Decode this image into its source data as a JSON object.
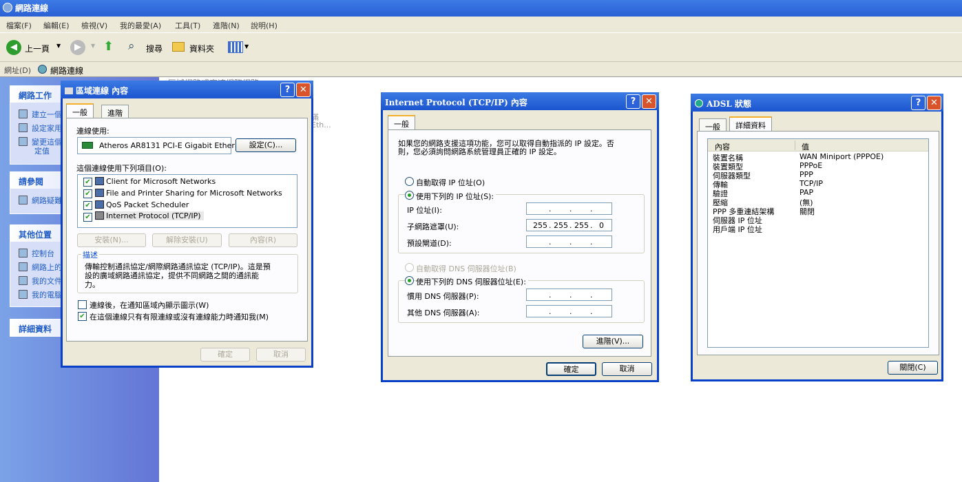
{
  "window": {
    "title": "網路連線"
  },
  "menu": [
    "檔案(F)",
    "編輯(E)",
    "檢視(V)",
    "我的最愛(A)",
    "工具(T)",
    "進階(N)",
    "說明(H)"
  ],
  "toolbar": {
    "back": "上一頁",
    "search": "搜尋",
    "folders": "資料夾"
  },
  "address": {
    "label": "網址(D)",
    "value": "網路連線"
  },
  "taskpane": {
    "network_tasks": {
      "title": "網路工作",
      "items": [
        "建立一個",
        "設定家用",
        "變更這個",
        "定值"
      ]
    },
    "see_also": {
      "title": "請參閱",
      "items": [
        "網路疑難"
      ]
    },
    "other_places": {
      "title": "其他位置",
      "items": [
        "控制台",
        "網路上的",
        "我的文件",
        "我的電腦"
      ]
    },
    "details": {
      "title": "詳細資料"
    }
  },
  "bg_fragments": [
    "區域網路或高速網際網路",
    "滿",
    "Eth..."
  ],
  "lan": {
    "title": "區域連線 內容",
    "tabs": [
      "一般",
      "進階"
    ],
    "connect_using_label": "連線使用:",
    "adapter": "Atheros AR8131 PCI-E Gigabit Ether",
    "configure": "設定(C)...",
    "items_label": "這個連線使用下列項目(O):",
    "items": [
      "Client for Microsoft Networks",
      "File and Printer Sharing for Microsoft Networks",
      "QoS Packet Scheduler",
      "Internet Protocol (TCP/IP)"
    ],
    "install": "安裝(N)...",
    "uninstall": "解除安裝(U)",
    "properties": "內容(R)",
    "desc_label": "描述",
    "desc_lines": [
      "傳輸控制通訊協定/網際網路通訊協定 (TCP/IP)。這是預",
      "設的廣域網路通訊協定，提供不同網路之間的通訊能",
      "力。"
    ],
    "show_icon": "連線後，在通知區域內顯示圖示(W)",
    "notify": "在這個連線只有有限連線或沒有連線能力時通知我(M)",
    "ok": "確定",
    "cancel": "取消"
  },
  "tcp": {
    "title": "Internet Protocol (TCP/IP) 內容",
    "tab": "一般",
    "intro_lines": [
      "如果您的網路支援這項功能，您可以取得自動指派的 IP 設定。否",
      "則，您必須詢問網路系統管理員正確的 IP 設定。"
    ],
    "auto_ip": "自動取得 IP 位址(O)",
    "use_ip": "使用下列的 IP 位址(S):",
    "ip_label": "IP 位址(I):",
    "mask_label": "子網路遮罩(U):",
    "gateway_label": "預設閘道(D):",
    "mask": [
      "255",
      "255",
      "255",
      "0"
    ],
    "auto_dns": "自動取得 DNS 伺服器位址(B)",
    "use_dns": "使用下列的 DNS 伺服器位址(E):",
    "pref_dns": "慣用 DNS 伺服器(P):",
    "alt_dns": "其他 DNS 伺服器(A):",
    "advanced": "進階(V)...",
    "ok": "確定",
    "cancel": "取消"
  },
  "adsl": {
    "title": "ADSL 狀態",
    "tabs": [
      "一般",
      "詳細資料"
    ],
    "col_prop": "內容",
    "col_val": "值",
    "rows": [
      {
        "k": "裝置名稱",
        "v": "WAN Miniport (PPPOE)"
      },
      {
        "k": "裝置類型",
        "v": "PPPoE"
      },
      {
        "k": "伺服器類型",
        "v": "PPP"
      },
      {
        "k": "傳輸",
        "v": "TCP/IP"
      },
      {
        "k": "驗證",
        "v": "PAP"
      },
      {
        "k": "壓縮",
        "v": "(無)"
      },
      {
        "k": "PPP 多重連結架構",
        "v": "關閉"
      },
      {
        "k": "伺服器 IP 位址",
        "v": ""
      },
      {
        "k": "用戶端 IP 位址",
        "v": ""
      }
    ],
    "close": "關閉(C)"
  }
}
